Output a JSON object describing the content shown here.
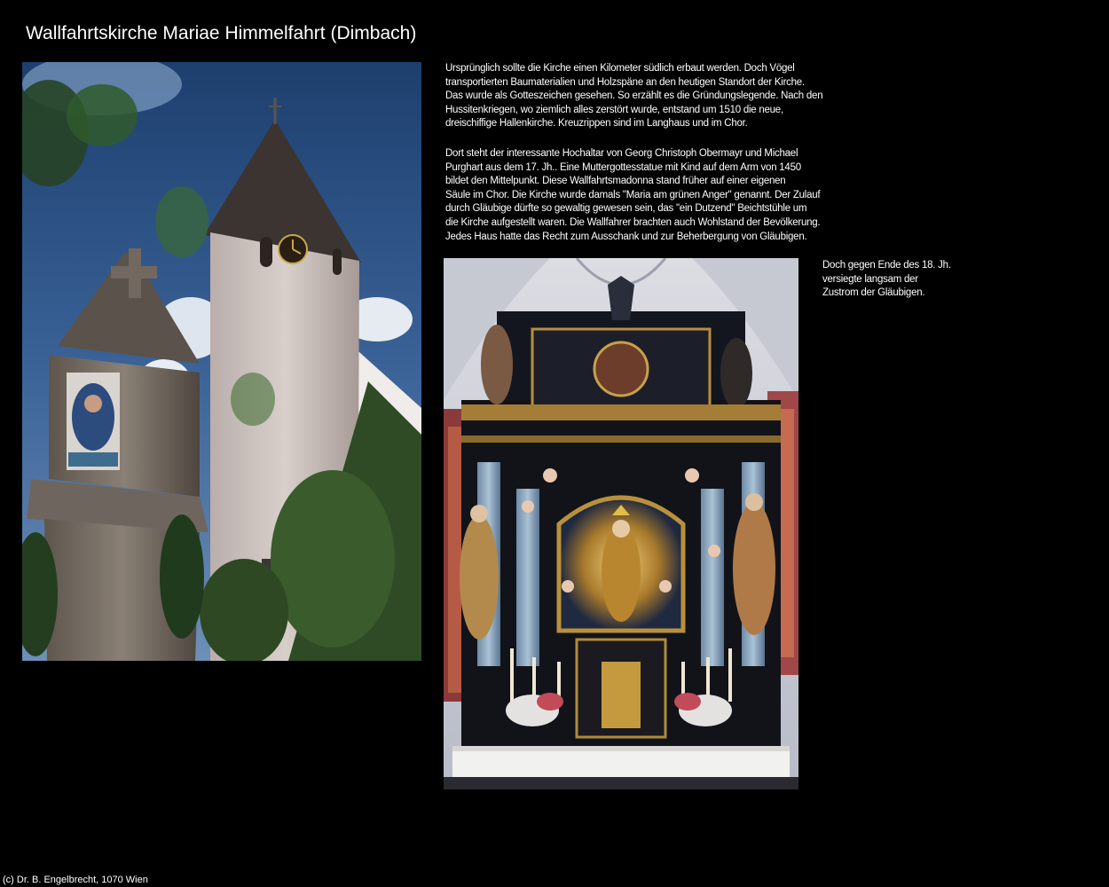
{
  "page": {
    "title": "Wallfahrtskirche Mariae Himmelfahrt (Dimbach)",
    "background_color": "#000000",
    "text_color": "#ffffff"
  },
  "text": {
    "paragraph_1_lines": [
      "Ursprünglich sollte die Kirche einen Kilometer südlich erbaut werden. Doch Vögel",
      "transportierten Baumaterialien und Holzspäne an den heutigen Standort der Kirche.",
      "Das wurde als Gotteszeichen gesehen. So erzählt es die Gründungslegende. Nach den",
      "Hussitenkriegen, wo ziemlich alles zerstört wurde, entstand um 1510 die neue,",
      "dreischiffige Hallenkirche. Kreuzrippen sind im Langhaus und im Chor."
    ],
    "paragraph_2_lines": [
      "Dort steht der interessante Hochaltar von Georg Christoph Obermayr und Michael",
      "Purghart aus dem 17. Jh.. Eine Muttergottesstatue mit Kind auf dem Arm von 1450",
      "bildet den Mittelpunkt. Diese Wallfahrtsmadonna stand früher auf einer eigenen",
      "Säule im Chor. Die Kirche wurde damals \"Maria am grünen Anger\" genannt. Der Zulauf",
      "durch Gläubige dürfte so gewaltig gewesen sein, das \"ein Dutzend\" Beichtstühle um",
      "die Kirche aufgestellt waren. Die Wallfahrer brachten auch Wohlstand der Bevölkerung.",
      "Jedes Haus hatte das Recht zum Ausschank und zur Beherbergung von Gläubigen."
    ],
    "paragraph_3_lines": [
      "Doch gegen Ende des 18. Jh.",
      "versiegte langsam der",
      "Zustrom der Gläubigen."
    ]
  },
  "footer": {
    "copyright": "(c) Dr. B. Engelbrecht, 1070 Wien"
  }
}
